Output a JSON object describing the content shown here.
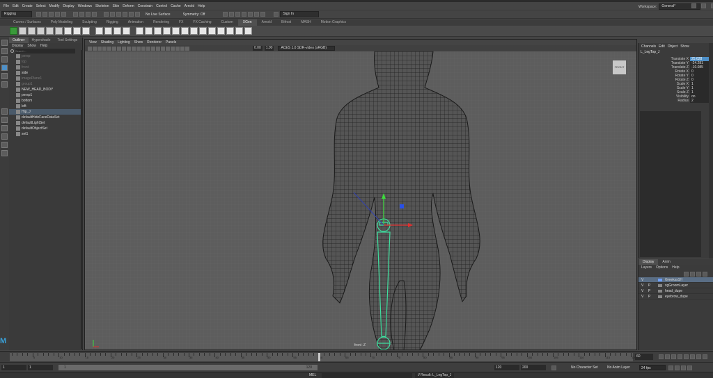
{
  "menubar": {
    "items": [
      "File",
      "Edit",
      "Create",
      "Select",
      "Modify",
      "Display",
      "Windows",
      "Skeleton",
      "Skin",
      "Deform",
      "Constrain",
      "Control",
      "Cache",
      "Arnold",
      "Help"
    ],
    "workspace_label": "Workspace:",
    "workspace_value": "General*"
  },
  "statusline": {
    "mode": "Rigging",
    "live_surface": "No Live Surface",
    "symmetry": "Symmetry: Off",
    "sign_in": "Sign In"
  },
  "shelf": {
    "tabs": [
      "Curves / Surfaces",
      "Poly Modeling",
      "Sculpting",
      "Rigging",
      "Animation",
      "Rendering",
      "FX",
      "FX Caching",
      "Custom",
      "XGen",
      "Arnold",
      "Bifrost",
      "MASH",
      "Motion Graphics"
    ],
    "active_tab": "XGen",
    "icon_names": [
      "xgen-icon",
      "create-desc-icon",
      "sphere-icon",
      "hair-icon",
      "cv-icon",
      "grooming-icon",
      "brush-icon",
      "clump-icon",
      "cut-icon",
      "noise-icon",
      "layers-icon",
      "curve-icon",
      "mesh-icon",
      "guide-icon",
      "region-icon",
      "sculpt-icon",
      "density-icon",
      "length-icon",
      "width-icon",
      "twist-icon",
      "pull-icon",
      "comb-icon",
      "smooth-icon",
      "freeze-icon",
      "delete-icon",
      "interactive-groom-icon"
    ]
  },
  "outliner": {
    "tabs": [
      "Outliner",
      "Hypershade",
      "Tool Settings"
    ],
    "active_tab": "Outliner",
    "menu": [
      "Display",
      "Show",
      "Help"
    ],
    "search_placeholder": "Search...",
    "items": [
      {
        "label": "persp",
        "dim": true,
        "type": "camera"
      },
      {
        "label": "top",
        "dim": true,
        "type": "camera"
      },
      {
        "label": "front",
        "dim": true,
        "type": "camera"
      },
      {
        "label": "side",
        "dim": false,
        "type": "camera"
      },
      {
        "label": "imagePlane1",
        "dim": true,
        "type": "image"
      },
      {
        "label": "group1",
        "dim": true,
        "type": "group"
      },
      {
        "label": "NEW_HEAD_BODY",
        "dim": false,
        "type": "mesh"
      },
      {
        "label": "persp1",
        "dim": false,
        "type": "camera"
      },
      {
        "label": "bottom",
        "dim": false,
        "type": "camera"
      },
      {
        "label": "left",
        "dim": false,
        "type": "camera"
      },
      {
        "label": "Hip_J",
        "dim": false,
        "type": "joint",
        "selected": true
      },
      {
        "label": "defaultHideFaceDataSet",
        "dim": false,
        "type": "set"
      },
      {
        "label": "defaultLightSet",
        "dim": false,
        "type": "set"
      },
      {
        "label": "defaultObjectSet",
        "dim": false,
        "type": "set"
      },
      {
        "label": "set1",
        "dim": false,
        "type": "set"
      }
    ]
  },
  "viewport": {
    "menu": [
      "View",
      "Shading",
      "Lighting",
      "Show",
      "Renderer",
      "Panels"
    ],
    "field_a": "0.00",
    "field_b": "1.00",
    "colorspace": "ACES 1.0 SDR-video (sRGB)",
    "camera_label": "front -Z",
    "viewcube_label": "FRONT"
  },
  "channelbox": {
    "menu": [
      "Channels",
      "Edit",
      "Object",
      "Show"
    ],
    "object_name": "L_LegTop_J",
    "attributes": [
      {
        "name": "Translate X",
        "value": "25.628",
        "highlight": true
      },
      {
        "name": "Translate Y",
        "value": "-24.281",
        "highlight": false
      },
      {
        "name": "Translate Z",
        "value": "-10.085",
        "highlight": false
      },
      {
        "name": "Rotate X",
        "value": "0",
        "highlight": false
      },
      {
        "name": "Rotate Y",
        "value": "0",
        "highlight": false
      },
      {
        "name": "Rotate Z",
        "value": "0",
        "highlight": false
      },
      {
        "name": "Scale X",
        "value": "1",
        "highlight": false
      },
      {
        "name": "Scale Y",
        "value": "1",
        "highlight": false
      },
      {
        "name": "Scale Z",
        "value": "1",
        "highlight": false
      },
      {
        "name": "Visibility",
        "value": "on",
        "highlight": false
      },
      {
        "name": "Radius",
        "value": "2",
        "highlight": false
      }
    ]
  },
  "layers": {
    "tabs": [
      "Display",
      "Anim"
    ],
    "active_tab": "Display",
    "menu": [
      "Layers",
      "Options",
      "Help"
    ],
    "items": [
      {
        "v": "V",
        "p": "",
        "name": "Greekss1H",
        "selected": true
      },
      {
        "v": "V",
        "p": "P",
        "name": "xgGroomLayer",
        "selected": false
      },
      {
        "v": "V",
        "p": "P",
        "name": "head_dupe",
        "selected": false
      },
      {
        "v": "V",
        "p": "P",
        "name": "eyebrow_dupe",
        "selected": false
      }
    ]
  },
  "timeline": {
    "start": 1,
    "end": 120,
    "current_frame": 60,
    "tick_labels": [
      "5",
      "10",
      "15",
      "20",
      "25",
      "30",
      "35",
      "40",
      "45",
      "50",
      "55",
      "60",
      "65",
      "70",
      "75",
      "80",
      "85",
      "90",
      "95",
      "100",
      "105",
      "110",
      "115",
      "120"
    ]
  },
  "rangebar": {
    "start_field": "1",
    "start_field2": "1",
    "range_start": "1",
    "range_end": "120",
    "end_field": "120",
    "end_field2": "200",
    "character_set": "No Character Set",
    "anim_layer": "No Anim Layer",
    "fps": "24 fps"
  },
  "cmdline": {
    "lang": "MEL",
    "result": "// Result: L_LegTop_J"
  }
}
